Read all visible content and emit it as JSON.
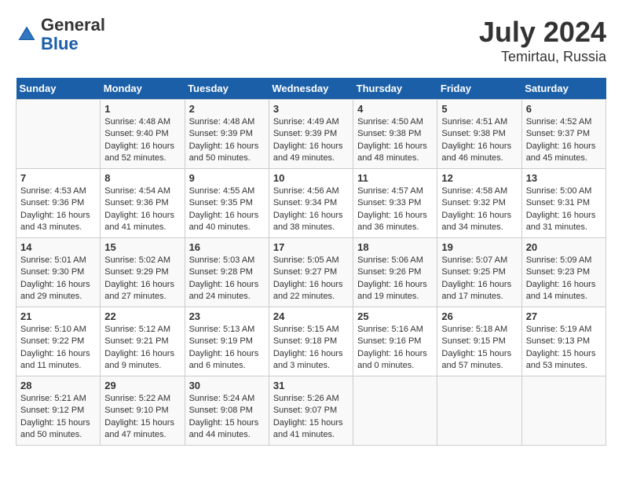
{
  "header": {
    "logo_general": "General",
    "logo_blue": "Blue",
    "title": "July 2024",
    "location": "Temirtau, Russia"
  },
  "calendar": {
    "days_of_week": [
      "Sunday",
      "Monday",
      "Tuesday",
      "Wednesday",
      "Thursday",
      "Friday",
      "Saturday"
    ],
    "weeks": [
      [
        {
          "day": "",
          "info": ""
        },
        {
          "day": "1",
          "info": "Sunrise: 4:48 AM\nSunset: 9:40 PM\nDaylight: 16 hours\nand 52 minutes."
        },
        {
          "day": "2",
          "info": "Sunrise: 4:48 AM\nSunset: 9:39 PM\nDaylight: 16 hours\nand 50 minutes."
        },
        {
          "day": "3",
          "info": "Sunrise: 4:49 AM\nSunset: 9:39 PM\nDaylight: 16 hours\nand 49 minutes."
        },
        {
          "day": "4",
          "info": "Sunrise: 4:50 AM\nSunset: 9:38 PM\nDaylight: 16 hours\nand 48 minutes."
        },
        {
          "day": "5",
          "info": "Sunrise: 4:51 AM\nSunset: 9:38 PM\nDaylight: 16 hours\nand 46 minutes."
        },
        {
          "day": "6",
          "info": "Sunrise: 4:52 AM\nSunset: 9:37 PM\nDaylight: 16 hours\nand 45 minutes."
        }
      ],
      [
        {
          "day": "7",
          "info": "Sunrise: 4:53 AM\nSunset: 9:36 PM\nDaylight: 16 hours\nand 43 minutes."
        },
        {
          "day": "8",
          "info": "Sunrise: 4:54 AM\nSunset: 9:36 PM\nDaylight: 16 hours\nand 41 minutes."
        },
        {
          "day": "9",
          "info": "Sunrise: 4:55 AM\nSunset: 9:35 PM\nDaylight: 16 hours\nand 40 minutes."
        },
        {
          "day": "10",
          "info": "Sunrise: 4:56 AM\nSunset: 9:34 PM\nDaylight: 16 hours\nand 38 minutes."
        },
        {
          "day": "11",
          "info": "Sunrise: 4:57 AM\nSunset: 9:33 PM\nDaylight: 16 hours\nand 36 minutes."
        },
        {
          "day": "12",
          "info": "Sunrise: 4:58 AM\nSunset: 9:32 PM\nDaylight: 16 hours\nand 34 minutes."
        },
        {
          "day": "13",
          "info": "Sunrise: 5:00 AM\nSunset: 9:31 PM\nDaylight: 16 hours\nand 31 minutes."
        }
      ],
      [
        {
          "day": "14",
          "info": "Sunrise: 5:01 AM\nSunset: 9:30 PM\nDaylight: 16 hours\nand 29 minutes."
        },
        {
          "day": "15",
          "info": "Sunrise: 5:02 AM\nSunset: 9:29 PM\nDaylight: 16 hours\nand 27 minutes."
        },
        {
          "day": "16",
          "info": "Sunrise: 5:03 AM\nSunset: 9:28 PM\nDaylight: 16 hours\nand 24 minutes."
        },
        {
          "day": "17",
          "info": "Sunrise: 5:05 AM\nSunset: 9:27 PM\nDaylight: 16 hours\nand 22 minutes."
        },
        {
          "day": "18",
          "info": "Sunrise: 5:06 AM\nSunset: 9:26 PM\nDaylight: 16 hours\nand 19 minutes."
        },
        {
          "day": "19",
          "info": "Sunrise: 5:07 AM\nSunset: 9:25 PM\nDaylight: 16 hours\nand 17 minutes."
        },
        {
          "day": "20",
          "info": "Sunrise: 5:09 AM\nSunset: 9:23 PM\nDaylight: 16 hours\nand 14 minutes."
        }
      ],
      [
        {
          "day": "21",
          "info": "Sunrise: 5:10 AM\nSunset: 9:22 PM\nDaylight: 16 hours\nand 11 minutes."
        },
        {
          "day": "22",
          "info": "Sunrise: 5:12 AM\nSunset: 9:21 PM\nDaylight: 16 hours\nand 9 minutes."
        },
        {
          "day": "23",
          "info": "Sunrise: 5:13 AM\nSunset: 9:19 PM\nDaylight: 16 hours\nand 6 minutes."
        },
        {
          "day": "24",
          "info": "Sunrise: 5:15 AM\nSunset: 9:18 PM\nDaylight: 16 hours\nand 3 minutes."
        },
        {
          "day": "25",
          "info": "Sunrise: 5:16 AM\nSunset: 9:16 PM\nDaylight: 16 hours\nand 0 minutes."
        },
        {
          "day": "26",
          "info": "Sunrise: 5:18 AM\nSunset: 9:15 PM\nDaylight: 15 hours\nand 57 minutes."
        },
        {
          "day": "27",
          "info": "Sunrise: 5:19 AM\nSunset: 9:13 PM\nDaylight: 15 hours\nand 53 minutes."
        }
      ],
      [
        {
          "day": "28",
          "info": "Sunrise: 5:21 AM\nSunset: 9:12 PM\nDaylight: 15 hours\nand 50 minutes."
        },
        {
          "day": "29",
          "info": "Sunrise: 5:22 AM\nSunset: 9:10 PM\nDaylight: 15 hours\nand 47 minutes."
        },
        {
          "day": "30",
          "info": "Sunrise: 5:24 AM\nSunset: 9:08 PM\nDaylight: 15 hours\nand 44 minutes."
        },
        {
          "day": "31",
          "info": "Sunrise: 5:26 AM\nSunset: 9:07 PM\nDaylight: 15 hours\nand 41 minutes."
        },
        {
          "day": "",
          "info": ""
        },
        {
          "day": "",
          "info": ""
        },
        {
          "day": "",
          "info": ""
        }
      ]
    ]
  }
}
